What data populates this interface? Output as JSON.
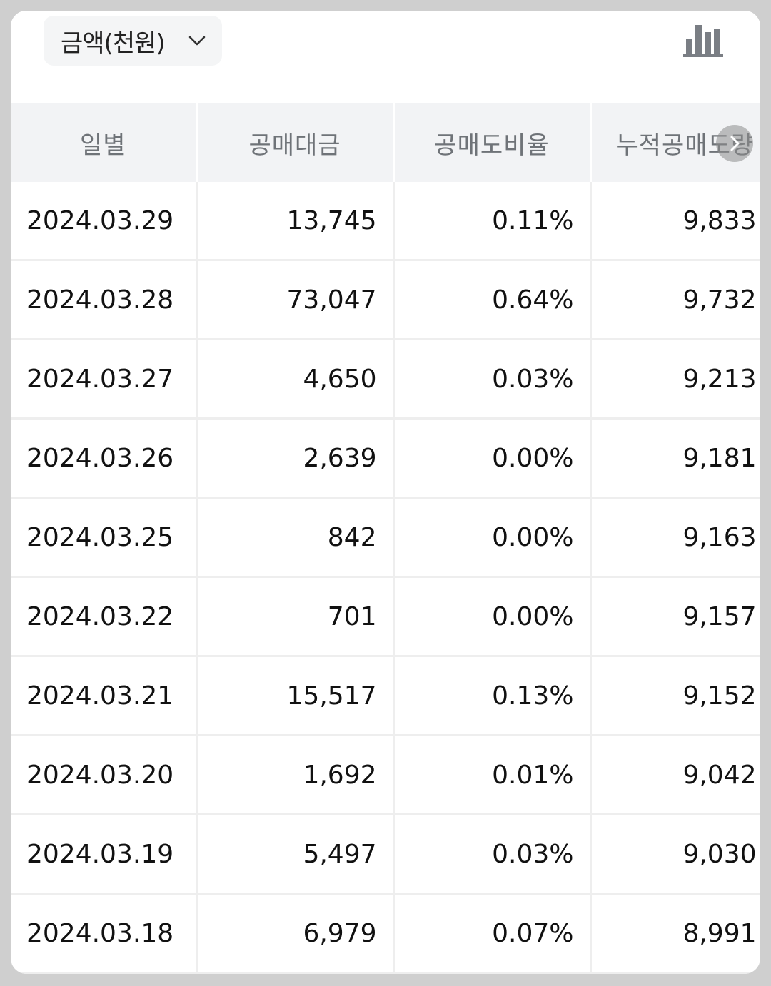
{
  "toolbar": {
    "unit_selector_label": "금액(천원)",
    "unit_selector_icon": "chevron-down-icon",
    "chart_toggle_icon": "bar-chart-icon"
  },
  "table": {
    "headers": [
      "일별",
      "공매대금",
      "공매도비율",
      "누적공매도량"
    ],
    "rows": [
      {
        "date": "2024.03.29",
        "amount": "13,745",
        "ratio": "0.11%",
        "cumulative": "9,833"
      },
      {
        "date": "2024.03.28",
        "amount": "73,047",
        "ratio": "0.64%",
        "cumulative": "9,732"
      },
      {
        "date": "2024.03.27",
        "amount": "4,650",
        "ratio": "0.03%",
        "cumulative": "9,213"
      },
      {
        "date": "2024.03.26",
        "amount": "2,639",
        "ratio": "0.00%",
        "cumulative": "9,181"
      },
      {
        "date": "2024.03.25",
        "amount": "842",
        "ratio": "0.00%",
        "cumulative": "9,163"
      },
      {
        "date": "2024.03.22",
        "amount": "701",
        "ratio": "0.00%",
        "cumulative": "9,157"
      },
      {
        "date": "2024.03.21",
        "amount": "15,517",
        "ratio": "0.13%",
        "cumulative": "9,152"
      },
      {
        "date": "2024.03.20",
        "amount": "1,692",
        "ratio": "0.01%",
        "cumulative": "9,042"
      },
      {
        "date": "2024.03.19",
        "amount": "5,497",
        "ratio": "0.03%",
        "cumulative": "9,030"
      },
      {
        "date": "2024.03.18",
        "amount": "6,979",
        "ratio": "0.07%",
        "cumulative": "8,991"
      }
    ]
  },
  "scroll_right_icon": "chevron-right-icon",
  "colors": {
    "background": "#cfcfcf",
    "card": "#ffffff",
    "header_bg": "#f2f3f5",
    "header_text": "#6f7378",
    "chart_icon": "#7a7e84"
  }
}
